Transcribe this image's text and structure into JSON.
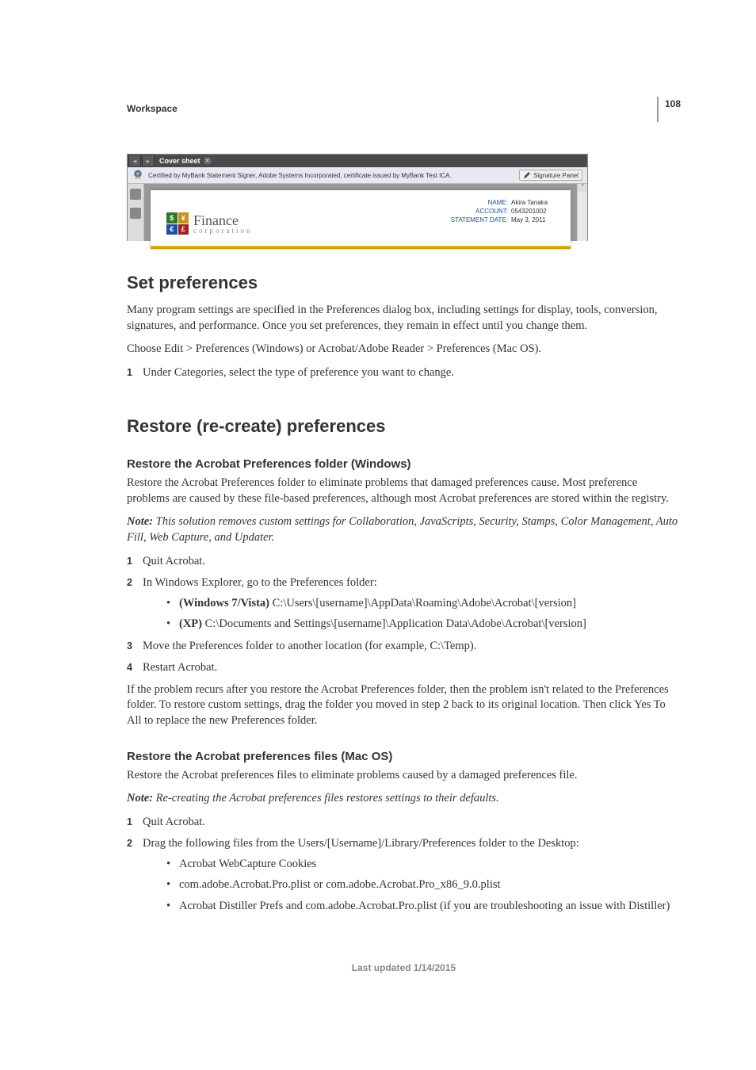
{
  "page_number": "108",
  "section_label": "Workspace",
  "screenshot": {
    "tab_label": "Cover sheet",
    "cert_text": "Certified by MyBank Statement Signer, Adobe Systems Incorporated, certificate issued by MyBank Test ICA.",
    "sig_panel_label": "Signature Panel",
    "logo_line1": "Finance",
    "logo_line2": "corporation",
    "info": {
      "name_label": "NAME:",
      "name_value": "Akira Tanaka",
      "account_label": "ACCOUNT:",
      "account_value": "0543201002",
      "date_label": "STATEMENT DATE:",
      "date_value": "May 3, 2011"
    }
  },
  "set_prefs": {
    "heading": "Set preferences",
    "p1": "Many program settings are specified in the Preferences dialog box, including settings for display, tools, conversion, signatures, and performance. Once you set preferences, they remain in effect until you change them.",
    "p2": "Choose Edit > Preferences (Windows) or Acrobat/Adobe Reader > Preferences (Mac OS).",
    "step1": "Under Categories, select the type of preference you want to change."
  },
  "restore": {
    "heading": "Restore (re-create) preferences",
    "win": {
      "subheading": "Restore the Acrobat Preferences folder (Windows)",
      "p1": "Restore the Acrobat Preferences folder to eliminate problems that damaged preferences cause. Most preference problems are caused by these file-based preferences, although most Acrobat preferences are stored within the registry.",
      "note_label": "Note:",
      "note_body": " This solution removes custom settings for Collaboration, JavaScripts, Security, Stamps, Color Management, Auto Fill, Web Capture, and Updater.",
      "s1": "Quit Acrobat.",
      "s2": "In Windows Explorer, go to the Preferences folder:",
      "s2_b1_bold": "(Windows 7/Vista)",
      "s2_b1_rest": " C:\\Users\\[username]\\AppData\\Roaming\\Adobe\\Acrobat\\[version]",
      "s2_b2_bold": "(XP)",
      "s2_b2_rest": " C:\\Documents and Settings\\[username]\\Application Data\\Adobe\\Acrobat\\[version]",
      "s3": "Move the Preferences folder to another location (for example, C:\\Temp).",
      "s4": "Restart Acrobat.",
      "p_after": "If the problem recurs after you restore the Acrobat Preferences folder, then the problem isn't related to the Preferences folder. To restore custom settings, drag the folder you moved in step 2 back to its original location. Then click Yes To All to replace the new Preferences folder."
    },
    "mac": {
      "subheading": "Restore the Acrobat preferences files (Mac OS)",
      "p1": "Restore the Acrobat preferences files to eliminate problems caused by a damaged preferences file.",
      "note_label": "Note:",
      "note_body": " Re-creating the Acrobat preferences files restores settings to their defaults.",
      "s1": "Quit Acrobat.",
      "s2": "Drag the following files from the Users/[Username]/Library/Preferences folder to the Desktop:",
      "s2_b1": "Acrobat WebCapture Cookies",
      "s2_b2": "com.adobe.Acrobat.Pro.plist or com.adobe.Acrobat.Pro_x86_9.0.plist",
      "s2_b3": "Acrobat Distiller Prefs and com.adobe.Acrobat.Pro.plist (if you are troubleshooting an issue with Distiller)"
    }
  },
  "footer": "Last updated 1/14/2015"
}
